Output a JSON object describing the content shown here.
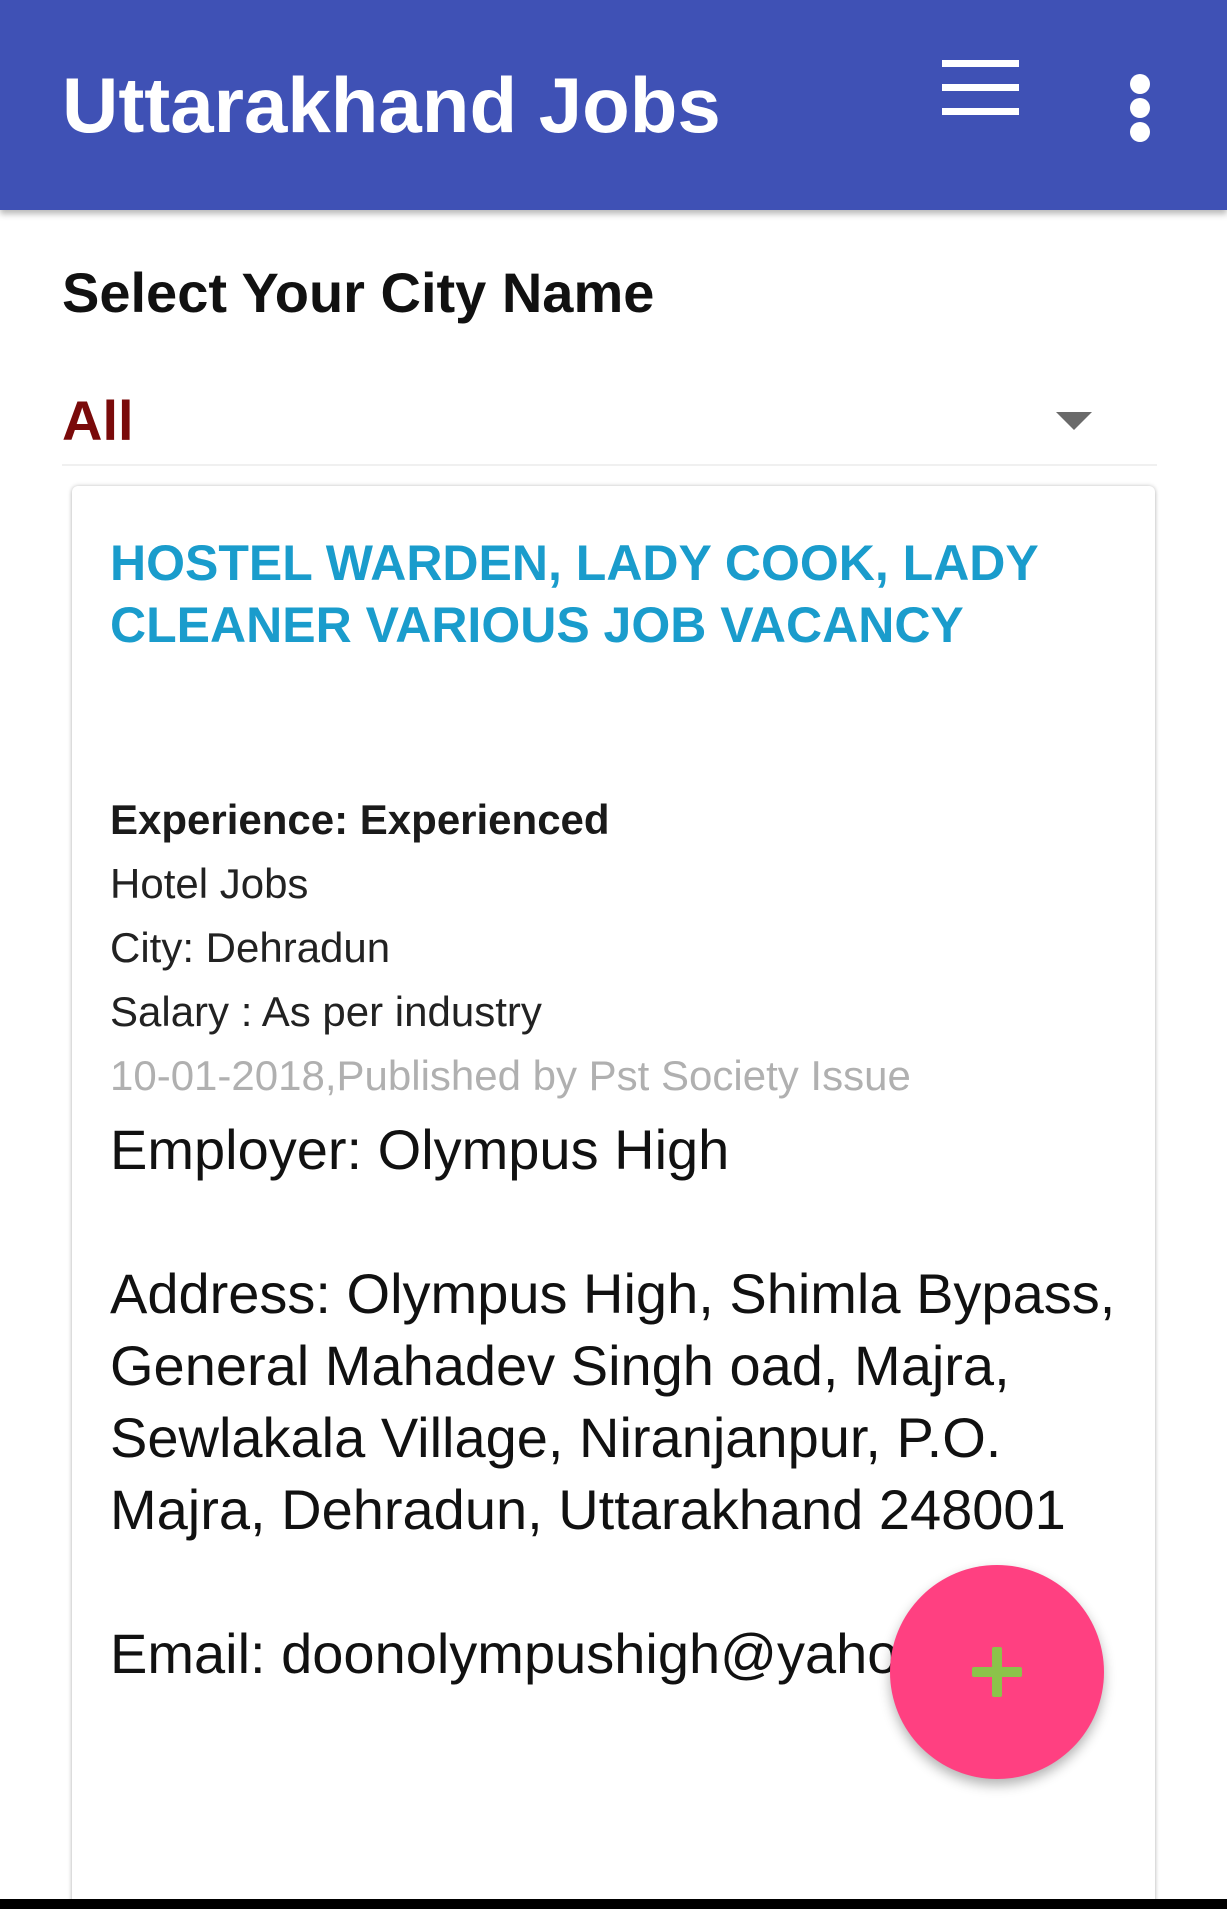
{
  "app_bar": {
    "title": "Uttarakhand Jobs",
    "background_color": "#3f51b5",
    "menu_icon": "hamburger-menu-icon",
    "overflow_icon": "more-vert-icon"
  },
  "city_select": {
    "heading": "Select Your City Name",
    "selected_value": "All",
    "arrow_icon": "dropdown-arrow-icon"
  },
  "job": {
    "title": "HOSTEL WARDEN, LADY COOK, LADY CLEANER VARIOUS JOB VACANCY",
    "experience": "Experience: Experienced",
    "category": "Hotel Jobs",
    "city": "City: Dehradun",
    "salary": "Salary : As per industry",
    "meta": "10-01-2018,Published by Pst Society Issue",
    "description": "Employer: Olympus High\n\nAddress: Olympus High, Shimla Bypass, General Mahadev Singh oad, Majra, Sewlakala Village, Niranjanpur, P.O. Majra, Dehradun, Uttarakhand 248001\n\nEmail: doonolympushigh@yahoo.co.in"
  },
  "fab": {
    "icon": "plus-icon",
    "color": "#ff4081",
    "icon_color": "#8bc34a"
  },
  "colors": {
    "title_accent": "#1a9ccc",
    "selected_city": "#7a0a0a",
    "meta_text": "#b0b0b0"
  }
}
